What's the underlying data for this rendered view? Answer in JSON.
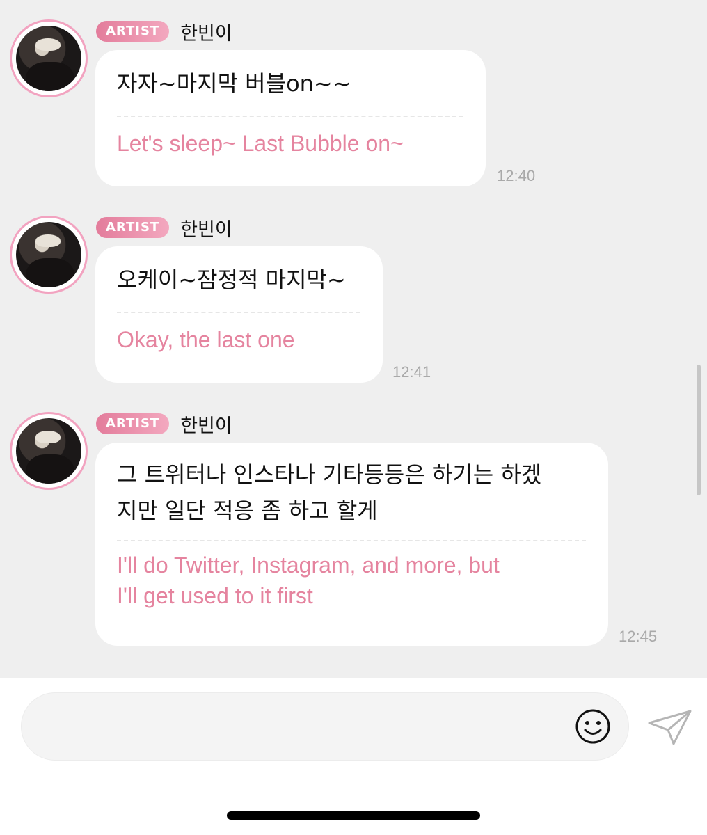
{
  "messages": [
    {
      "badge": "ARTIST",
      "name": "한빈이",
      "korean": "자자~마지막 버블on~~",
      "english": "Let's sleep~ Last Bubble on~",
      "time": "12:40"
    },
    {
      "badge": "ARTIST",
      "name": "한빈이",
      "korean": "오케이~잠정적 마지막~",
      "english": "Okay, the last one",
      "time": "12:41"
    },
    {
      "badge": "ARTIST",
      "name": "한빈이",
      "korean_lines": [
        "그 트위터나 인스타나 기타등등은 하기는 하겠",
        "지만 일단 적응 좀 하고 할게"
      ],
      "english_lines": [
        "I'll do Twitter, Instagram, and more, but",
        "I'll get used to it first"
      ],
      "time": "12:45"
    }
  ],
  "composer": {
    "emoji_icon": "smiley-icon",
    "send_icon": "paper-plane-icon"
  },
  "colors": {
    "accent": "#e5849f",
    "badge": "#e37c9b",
    "background": "#efefef"
  }
}
